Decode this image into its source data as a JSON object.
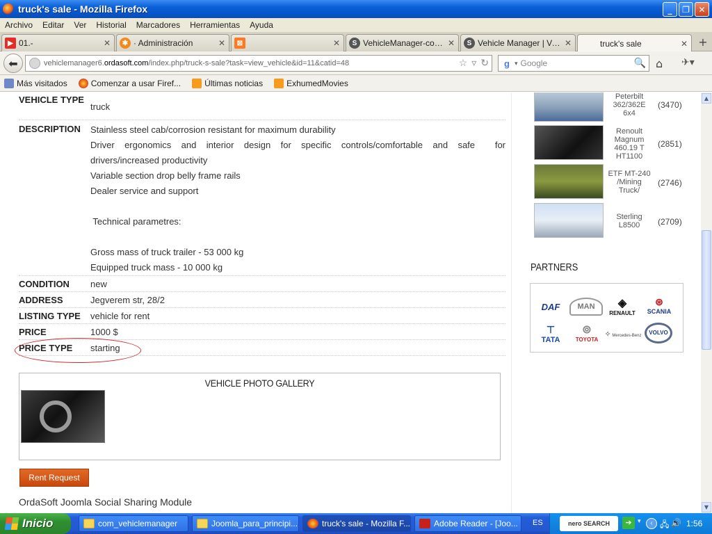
{
  "window": {
    "title": "truck's sale - Mozilla Firefox"
  },
  "menu": [
    "Archivo",
    "Editar",
    "Ver",
    "Historial",
    "Marcadores",
    "Herramientas",
    "Ayuda"
  ],
  "tabs": [
    {
      "label": "01.-",
      "icon": "youtube-icon"
    },
    {
      "label": "· Administración",
      "icon": "joomla-icon"
    },
    {
      "label": "",
      "icon": "xampp-icon"
    },
    {
      "label": "VehicleManager-compo...",
      "icon": "s-icon"
    },
    {
      "label": "Vehicle Manager | Vehic...",
      "icon": "s-icon"
    },
    {
      "label": "truck's sale",
      "icon": ""
    }
  ],
  "nav": {
    "url_prefix": "vehiclemanager6.",
    "url_host": "ordasoft.com",
    "url_path": "/index.php/truck-s-sale?task=view_vehicle&id=11&catid=48",
    "search_placeholder": "Google"
  },
  "bookmarks": [
    "Más visitados",
    "Comenzar a usar Firef...",
    "Últimas noticias",
    "ExhumedMovies"
  ],
  "details": {
    "vehicle_type_label": "VEHICLE TYPE",
    "vehicle_type": "truck",
    "description_label": "DESCRIPTION",
    "description_lines": [
      "Stainless steel cab/corrosion resistant for maximum durability",
      "Driver ergonomics and interior design for specific controls/comfortable and safe  for drivers/increased productivity",
      "Variable section drop belly frame rails",
      "Dealer service and support",
      "",
      " Technical parametres:",
      "",
      "Gross mass of truck trailer - 53 000 kg",
      "Equipped truck mass - 10 000 kg"
    ],
    "condition_label": "CONDITION",
    "condition": "new",
    "address_label": "ADDRESS",
    "address": "Jegverem str, 28/2",
    "listing_type_label": "LISTING TYPE",
    "listing_type": "vehicle for rent",
    "price_label": "PRICE",
    "price": "1000 $",
    "price_type_label": "PRICE TYPE",
    "price_type": "starting"
  },
  "gallery": {
    "title": "VEHICLE PHOTO GALLERY"
  },
  "rent_button": "Rent Request",
  "sharing_title": "OrdaSoft Joomla Social Sharing Module",
  "side_vehicles": [
    {
      "name": "Peterbilt 362/362E 6x4",
      "count": "(3470)"
    },
    {
      "name": "Renoult Magnum 460.19 T HT1100",
      "count": "(2851)"
    },
    {
      "name": "ETF MT-240 /Mining Truck/",
      "count": "(2746)"
    },
    {
      "name": "Sterling L8500",
      "count": "(2709)"
    }
  ],
  "partners": {
    "title": "PARTNERS",
    "logos": [
      "DAF",
      "MAN",
      "RENAULT",
      "SCANIA",
      "TATA",
      "TOYOTA",
      "Mercedes-Benz",
      "VOLVO"
    ]
  },
  "taskbar": {
    "start": "Inicio",
    "tasks": [
      "com_vehiclemanager",
      "Joomla_para_principi...",
      "truck's sale - Mozilla F...",
      "Adobe Reader - [Joo..."
    ],
    "lang": "ES",
    "tray_logo": "nero SEARCH",
    "clock": "1:56"
  },
  "colors": {
    "accent": "#0553c4",
    "rent_button": "#d9581a",
    "highlight_circle": "#d12a2a"
  }
}
